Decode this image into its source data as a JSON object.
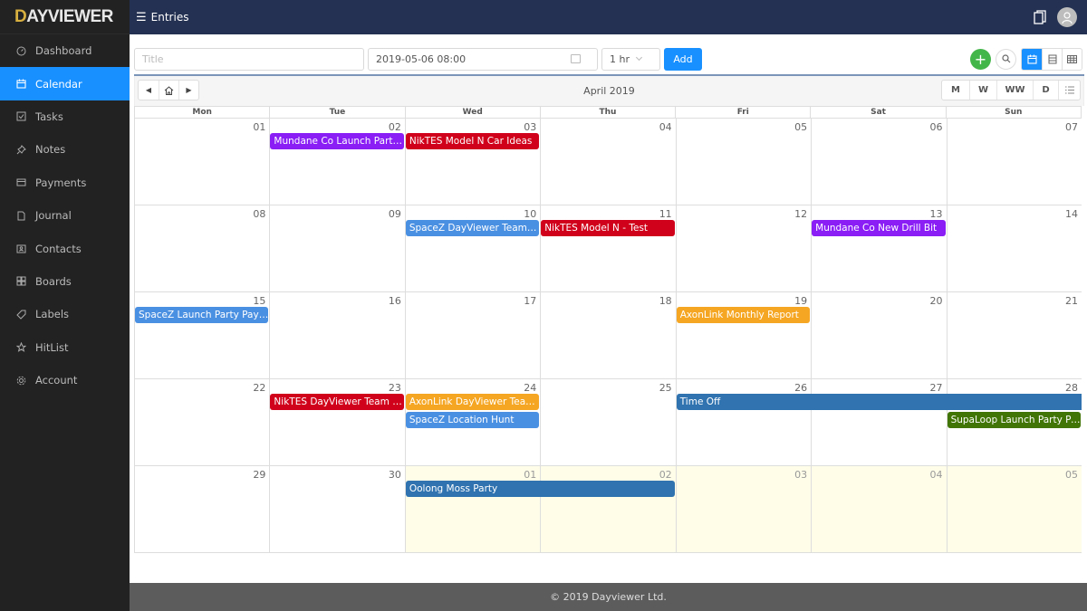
{
  "app": {
    "logo_prefix": "D",
    "logo_rest": "AYVIEWER"
  },
  "sidebar": {
    "items": [
      {
        "label": "Dashboard",
        "icon": "dashboard-icon",
        "active": false
      },
      {
        "label": "Calendar",
        "icon": "calendar-icon",
        "active": true
      },
      {
        "label": "Tasks",
        "icon": "checkbox-icon",
        "active": false
      },
      {
        "label": "Notes",
        "icon": "pin-icon",
        "active": false
      },
      {
        "label": "Payments",
        "icon": "card-icon",
        "active": false
      },
      {
        "label": "Journal",
        "icon": "book-icon",
        "active": false
      },
      {
        "label": "Contacts",
        "icon": "contacts-icon",
        "active": false
      },
      {
        "label": "Boards",
        "icon": "boards-icon",
        "active": false
      },
      {
        "label": "Labels",
        "icon": "tag-icon",
        "active": false
      },
      {
        "label": "HitList",
        "icon": "star-icon",
        "active": false
      },
      {
        "label": "Account",
        "icon": "gear-icon",
        "active": false
      }
    ]
  },
  "topbar": {
    "menu_label": "Entries"
  },
  "entry_form": {
    "title_placeholder": "Title",
    "datetime_value": "2019-05-06 08:00",
    "duration_value": "1 hr",
    "add_label": "Add"
  },
  "calendar": {
    "month_label": "April 2019",
    "modes": [
      "M",
      "W",
      "WW",
      "D"
    ],
    "weekdays": [
      "Mon",
      "Tue",
      "Wed",
      "Thu",
      "Fri",
      "Sat",
      "Sun"
    ],
    "weeks": [
      {
        "days": [
          {
            "n": "01"
          },
          {
            "n": "02"
          },
          {
            "n": "03"
          },
          {
            "n": "04"
          },
          {
            "n": "05"
          },
          {
            "n": "06"
          },
          {
            "n": "07"
          }
        ],
        "events": [
          {
            "title": "Mundane Co Launch Party Payment",
            "display": "Mundane Co Launch Party ...",
            "start": 1,
            "span": 1,
            "row": 0,
            "color": "#8a1ef5"
          },
          {
            "title": "NikTES Model N Car Ideas",
            "display": "NikTES Model N Car Ideas",
            "start": 2,
            "span": 1,
            "row": 0,
            "color": "#d0021b"
          }
        ]
      },
      {
        "days": [
          {
            "n": "08"
          },
          {
            "n": "09"
          },
          {
            "n": "10"
          },
          {
            "n": "11"
          },
          {
            "n": "12"
          },
          {
            "n": "13"
          },
          {
            "n": "14"
          }
        ],
        "events": [
          {
            "title": "SpaceZ DayViewer Team Room",
            "display": "SpaceZ DayViewer Team Ro...",
            "start": 2,
            "span": 1,
            "row": 0,
            "color": "#4a90e2"
          },
          {
            "title": "NikTES Model N - Test",
            "display": "NikTES Model N - Test",
            "start": 3,
            "span": 1,
            "row": 0,
            "color": "#d0021b"
          },
          {
            "title": "Mundane Co New Drill Bit",
            "display": "Mundane Co New Drill Bit",
            "start": 5,
            "span": 1,
            "row": 0,
            "color": "#8a1ef5"
          }
        ]
      },
      {
        "days": [
          {
            "n": "15"
          },
          {
            "n": "16"
          },
          {
            "n": "17"
          },
          {
            "n": "18"
          },
          {
            "n": "19"
          },
          {
            "n": "20"
          },
          {
            "n": "21"
          }
        ],
        "events": [
          {
            "title": "SpaceZ Launch Party Payment",
            "display": "SpaceZ Launch Party Paym...",
            "start": 0,
            "span": 1,
            "row": 0,
            "color": "#4a90e2"
          },
          {
            "title": "AxonLink Monthly Report",
            "display": "AxonLink Monthly Report",
            "start": 4,
            "span": 1,
            "row": 0,
            "color": "#f5a623"
          }
        ]
      },
      {
        "days": [
          {
            "n": "22"
          },
          {
            "n": "23"
          },
          {
            "n": "24"
          },
          {
            "n": "25"
          },
          {
            "n": "26"
          },
          {
            "n": "27"
          },
          {
            "n": "28"
          }
        ],
        "events": [
          {
            "title": "NikTES DayViewer Team Room",
            "display": "NikTES DayViewer Team Room",
            "start": 1,
            "span": 1,
            "row": 0,
            "color": "#d0021b"
          },
          {
            "title": "AxonLink DayViewer Team Room",
            "display": "AxonLink DayViewer Team ...",
            "start": 2,
            "span": 1,
            "row": 0,
            "color": "#f5a623"
          },
          {
            "title": "SpaceZ Location Hunt",
            "display": "SpaceZ Location Hunt",
            "start": 2,
            "span": 1,
            "row": 1,
            "color": "#4a90e2"
          },
          {
            "title": "Time Off",
            "display": "Time Off",
            "start": 4,
            "span": 3,
            "row": 0,
            "color": "#3073b0",
            "continues": true
          },
          {
            "title": "SupaLoop Launch Party Payment",
            "display": "SupaLoop Launch Party Pa...",
            "start": 6,
            "span": 1,
            "row": 1,
            "color": "#417505"
          }
        ]
      },
      {
        "days": [
          {
            "n": "29"
          },
          {
            "n": "30"
          },
          {
            "n": "01",
            "other": true
          },
          {
            "n": "02",
            "other": true
          },
          {
            "n": "03",
            "other": true
          },
          {
            "n": "04",
            "other": true
          },
          {
            "n": "05",
            "other": true
          }
        ],
        "events": [
          {
            "title": "Oolong Moss Party",
            "display": "Oolong Moss Party",
            "start": 2,
            "span": 2,
            "row": 0,
            "color": "#3073b0"
          }
        ]
      }
    ]
  },
  "footer": {
    "text": "© 2019 Dayviewer Ltd."
  },
  "colors": {
    "accent": "#1890ff",
    "topbar": "#243152",
    "sidebar": "#222222",
    "add_green": "#43b649"
  }
}
